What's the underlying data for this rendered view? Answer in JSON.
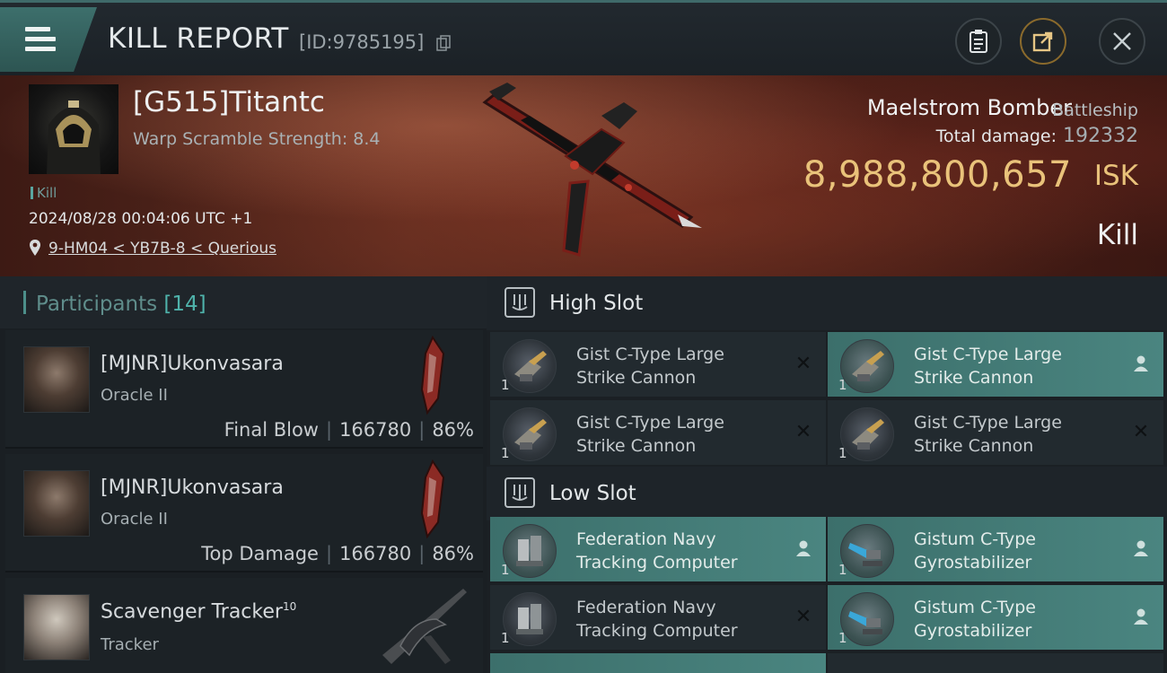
{
  "header": {
    "title": "KILL REPORT",
    "report_id": "[ID:9785195]"
  },
  "victim": {
    "name": "[G515]Titantc",
    "scramble": "Warp Scramble Strength: 8.4",
    "tag": "Kill",
    "timestamp": "2024/08/28 00:04:06 UTC +1",
    "location": "9-HM04 < YB7B-8 < Querious",
    "ship_name": "Maelstrom Bomber",
    "ship_class": "Battleship",
    "damage_label": "Total damage:",
    "damage_value": "192332",
    "isk_value": "8,988,800,657",
    "isk_unit": "ISK",
    "result": "Kill"
  },
  "participants": {
    "label": "Participants",
    "count": "[14]",
    "items": [
      {
        "name": "[MJNR]Ukonvasara",
        "ship": "Oracle II",
        "role": "Final Blow",
        "damage": "166780",
        "percent": "86%"
      },
      {
        "name": "[MJNR]Ukonvasara",
        "ship": "Oracle II",
        "role": "Top Damage",
        "damage": "166780",
        "percent": "86%"
      },
      {
        "name": "Scavenger Tracker",
        "level": "10",
        "ship": "Tracker"
      }
    ]
  },
  "high_slot": {
    "label": "High Slot",
    "modules": [
      {
        "line1": "Gist C-Type Large",
        "line2": "Strike Cannon",
        "qty": "1"
      },
      {
        "line1": "Gist C-Type Large",
        "line2": "Strike Cannon",
        "qty": "1"
      },
      {
        "line1": "Gist C-Type Large",
        "line2": "Strike Cannon",
        "qty": "1"
      },
      {
        "line1": "Gist C-Type Large",
        "line2": "Strike Cannon",
        "qty": "1"
      }
    ]
  },
  "low_slot": {
    "label": "Low Slot",
    "modules": [
      {
        "line1": "Federation Navy",
        "line2": "Tracking Computer",
        "qty": "1"
      },
      {
        "line1": "Gistum C-Type",
        "line2": "Gyrostabilizer",
        "qty": "1"
      },
      {
        "line1": "Federation Navy",
        "line2": "Tracking Computer",
        "qty": "1"
      },
      {
        "line1": "Gistum C-Type",
        "line2": "Gyrostabilizer",
        "qty": "1"
      }
    ]
  },
  "colors": {
    "accent_teal": "#4a8580",
    "isk_gold": "#e9c27a"
  }
}
